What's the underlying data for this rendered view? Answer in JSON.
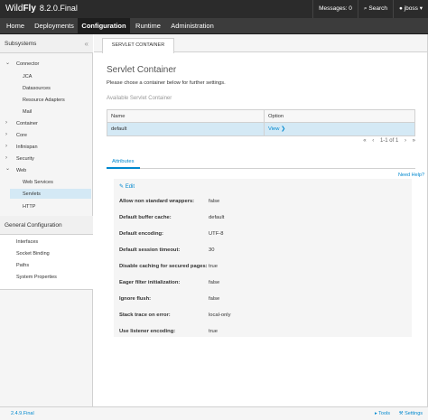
{
  "header": {
    "brand_thin": "Wild",
    "brand_bold": "Fly",
    "version": "8.2.0.Final",
    "messages": "Messages: 0",
    "search": "Search",
    "user": "jboss"
  },
  "nav": {
    "items": [
      "Home",
      "Deployments",
      "Configuration",
      "Runtime",
      "Administration"
    ],
    "active": "Configuration"
  },
  "sidebar": {
    "subsystems_title": "Subsystems",
    "collapse_glyph": "«",
    "tree": {
      "connector": "Connector",
      "jca": "JCA",
      "datasources": "Datasources",
      "resource_adapters": "Resource Adapters",
      "mail": "Mail",
      "container": "Container",
      "core": "Core",
      "infinispan": "Infinispan",
      "security": "Security",
      "web": "Web",
      "web_services": "Web Services",
      "servlets": "Servlets",
      "http": "HTTP"
    },
    "general_title": "General Configuration",
    "general_items": [
      "Interfaces",
      "Socket Binding",
      "Paths",
      "System Properties"
    ]
  },
  "main": {
    "tab_label": "SERVLET CONTAINER",
    "title": "Servlet Container",
    "description": "Please chose a container below for further settings.",
    "section_heading": "Available Servlet Container",
    "table": {
      "col_name": "Name",
      "col_option": "Option",
      "rows": [
        {
          "name": "default",
          "option": "View"
        }
      ]
    },
    "pager": {
      "first": "«",
      "prev": "‹",
      "info": "1-1 of 1",
      "next": "›",
      "last": "»"
    },
    "subtab": "Attributes",
    "need_help": "Need Help?",
    "edit": "Edit",
    "attributes": [
      {
        "label": "Allow non standard wrappers:",
        "value": "false"
      },
      {
        "label": "Default buffer cache:",
        "value": "default"
      },
      {
        "label": "Default encoding:",
        "value": "UTF-8"
      },
      {
        "label": "Default session timeout:",
        "value": "30"
      },
      {
        "label": "Disable caching for secured pages:",
        "value": "true"
      },
      {
        "label": "Eager filter initialization:",
        "value": "false"
      },
      {
        "label": "Ignore flush:",
        "value": "false"
      },
      {
        "label": "Stack trace on error:",
        "value": "local-only"
      },
      {
        "label": "Use listener encoding:",
        "value": "true"
      }
    ]
  },
  "footer": {
    "version": "2.4.9.Final",
    "tools": "Tools",
    "settings": "Settings"
  },
  "colors": {
    "header_bg": "#2b2b2b",
    "nav_bg": "#3c3c3c",
    "link": "#0088ce",
    "selection": "#d4e9f5"
  }
}
